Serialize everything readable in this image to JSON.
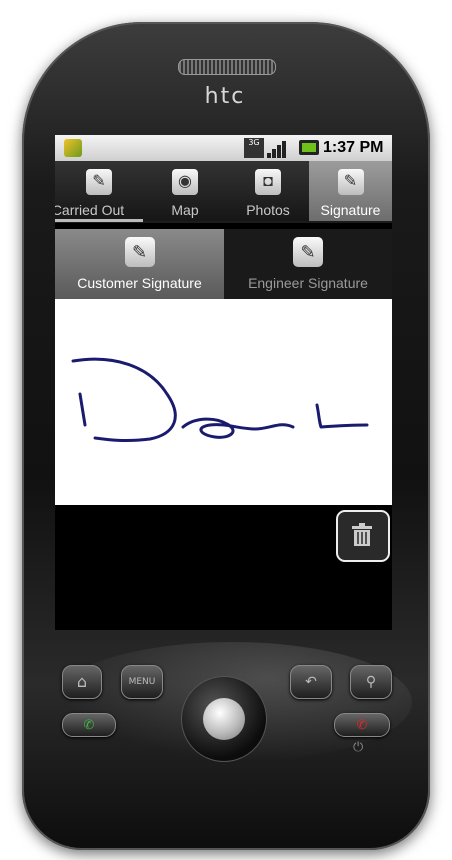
{
  "device": {
    "brand": "htc"
  },
  "status_bar": {
    "network": "3G",
    "time": "1:37 PM",
    "icons": [
      "app-icon",
      "3g-icon",
      "signal-icon",
      "battery-icon"
    ]
  },
  "tabs": [
    {
      "label": "Carried Out",
      "icon": "notepad-icon",
      "active": false
    },
    {
      "label": "Map",
      "icon": "globe-icon",
      "active": false
    },
    {
      "label": "Photos",
      "icon": "camera-icon",
      "active": false
    },
    {
      "label": "Signature",
      "icon": "pen-icon",
      "active": true
    }
  ],
  "subtabs": [
    {
      "label": "Customer Signature",
      "icon": "pen-icon",
      "active": true
    },
    {
      "label": "Engineer Signature",
      "icon": "pen-icon",
      "active": false
    }
  ],
  "signature": {
    "ink_color": "#1a1a6e"
  },
  "actions": {
    "clear": "trash-icon"
  },
  "hardware_buttons": [
    "home-button",
    "menu-button",
    "back-button",
    "search-button",
    "call-button",
    "end-call-button"
  ]
}
